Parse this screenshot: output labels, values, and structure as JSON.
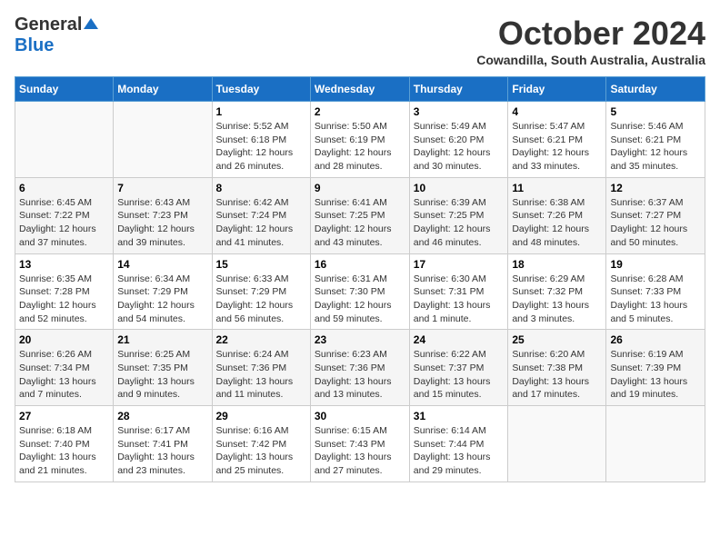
{
  "logo": {
    "general": "General",
    "blue": "Blue"
  },
  "title": "October 2024",
  "location": "Cowandilla, South Australia, Australia",
  "days_of_week": [
    "Sunday",
    "Monday",
    "Tuesday",
    "Wednesday",
    "Thursday",
    "Friday",
    "Saturday"
  ],
  "weeks": [
    [
      {
        "day": "",
        "info": ""
      },
      {
        "day": "",
        "info": ""
      },
      {
        "day": "1",
        "info": "Sunrise: 5:52 AM\nSunset: 6:18 PM\nDaylight: 12 hours and 26 minutes."
      },
      {
        "day": "2",
        "info": "Sunrise: 5:50 AM\nSunset: 6:19 PM\nDaylight: 12 hours and 28 minutes."
      },
      {
        "day": "3",
        "info": "Sunrise: 5:49 AM\nSunset: 6:20 PM\nDaylight: 12 hours and 30 minutes."
      },
      {
        "day": "4",
        "info": "Sunrise: 5:47 AM\nSunset: 6:21 PM\nDaylight: 12 hours and 33 minutes."
      },
      {
        "day": "5",
        "info": "Sunrise: 5:46 AM\nSunset: 6:21 PM\nDaylight: 12 hours and 35 minutes."
      }
    ],
    [
      {
        "day": "6",
        "info": "Sunrise: 6:45 AM\nSunset: 7:22 PM\nDaylight: 12 hours and 37 minutes."
      },
      {
        "day": "7",
        "info": "Sunrise: 6:43 AM\nSunset: 7:23 PM\nDaylight: 12 hours and 39 minutes."
      },
      {
        "day": "8",
        "info": "Sunrise: 6:42 AM\nSunset: 7:24 PM\nDaylight: 12 hours and 41 minutes."
      },
      {
        "day": "9",
        "info": "Sunrise: 6:41 AM\nSunset: 7:25 PM\nDaylight: 12 hours and 43 minutes."
      },
      {
        "day": "10",
        "info": "Sunrise: 6:39 AM\nSunset: 7:25 PM\nDaylight: 12 hours and 46 minutes."
      },
      {
        "day": "11",
        "info": "Sunrise: 6:38 AM\nSunset: 7:26 PM\nDaylight: 12 hours and 48 minutes."
      },
      {
        "day": "12",
        "info": "Sunrise: 6:37 AM\nSunset: 7:27 PM\nDaylight: 12 hours and 50 minutes."
      }
    ],
    [
      {
        "day": "13",
        "info": "Sunrise: 6:35 AM\nSunset: 7:28 PM\nDaylight: 12 hours and 52 minutes."
      },
      {
        "day": "14",
        "info": "Sunrise: 6:34 AM\nSunset: 7:29 PM\nDaylight: 12 hours and 54 minutes."
      },
      {
        "day": "15",
        "info": "Sunrise: 6:33 AM\nSunset: 7:29 PM\nDaylight: 12 hours and 56 minutes."
      },
      {
        "day": "16",
        "info": "Sunrise: 6:31 AM\nSunset: 7:30 PM\nDaylight: 12 hours and 59 minutes."
      },
      {
        "day": "17",
        "info": "Sunrise: 6:30 AM\nSunset: 7:31 PM\nDaylight: 13 hours and 1 minute."
      },
      {
        "day": "18",
        "info": "Sunrise: 6:29 AM\nSunset: 7:32 PM\nDaylight: 13 hours and 3 minutes."
      },
      {
        "day": "19",
        "info": "Sunrise: 6:28 AM\nSunset: 7:33 PM\nDaylight: 13 hours and 5 minutes."
      }
    ],
    [
      {
        "day": "20",
        "info": "Sunrise: 6:26 AM\nSunset: 7:34 PM\nDaylight: 13 hours and 7 minutes."
      },
      {
        "day": "21",
        "info": "Sunrise: 6:25 AM\nSunset: 7:35 PM\nDaylight: 13 hours and 9 minutes."
      },
      {
        "day": "22",
        "info": "Sunrise: 6:24 AM\nSunset: 7:36 PM\nDaylight: 13 hours and 11 minutes."
      },
      {
        "day": "23",
        "info": "Sunrise: 6:23 AM\nSunset: 7:36 PM\nDaylight: 13 hours and 13 minutes."
      },
      {
        "day": "24",
        "info": "Sunrise: 6:22 AM\nSunset: 7:37 PM\nDaylight: 13 hours and 15 minutes."
      },
      {
        "day": "25",
        "info": "Sunrise: 6:20 AM\nSunset: 7:38 PM\nDaylight: 13 hours and 17 minutes."
      },
      {
        "day": "26",
        "info": "Sunrise: 6:19 AM\nSunset: 7:39 PM\nDaylight: 13 hours and 19 minutes."
      }
    ],
    [
      {
        "day": "27",
        "info": "Sunrise: 6:18 AM\nSunset: 7:40 PM\nDaylight: 13 hours and 21 minutes."
      },
      {
        "day": "28",
        "info": "Sunrise: 6:17 AM\nSunset: 7:41 PM\nDaylight: 13 hours and 23 minutes."
      },
      {
        "day": "29",
        "info": "Sunrise: 6:16 AM\nSunset: 7:42 PM\nDaylight: 13 hours and 25 minutes."
      },
      {
        "day": "30",
        "info": "Sunrise: 6:15 AM\nSunset: 7:43 PM\nDaylight: 13 hours and 27 minutes."
      },
      {
        "day": "31",
        "info": "Sunrise: 6:14 AM\nSunset: 7:44 PM\nDaylight: 13 hours and 29 minutes."
      },
      {
        "day": "",
        "info": ""
      },
      {
        "day": "",
        "info": ""
      }
    ]
  ]
}
